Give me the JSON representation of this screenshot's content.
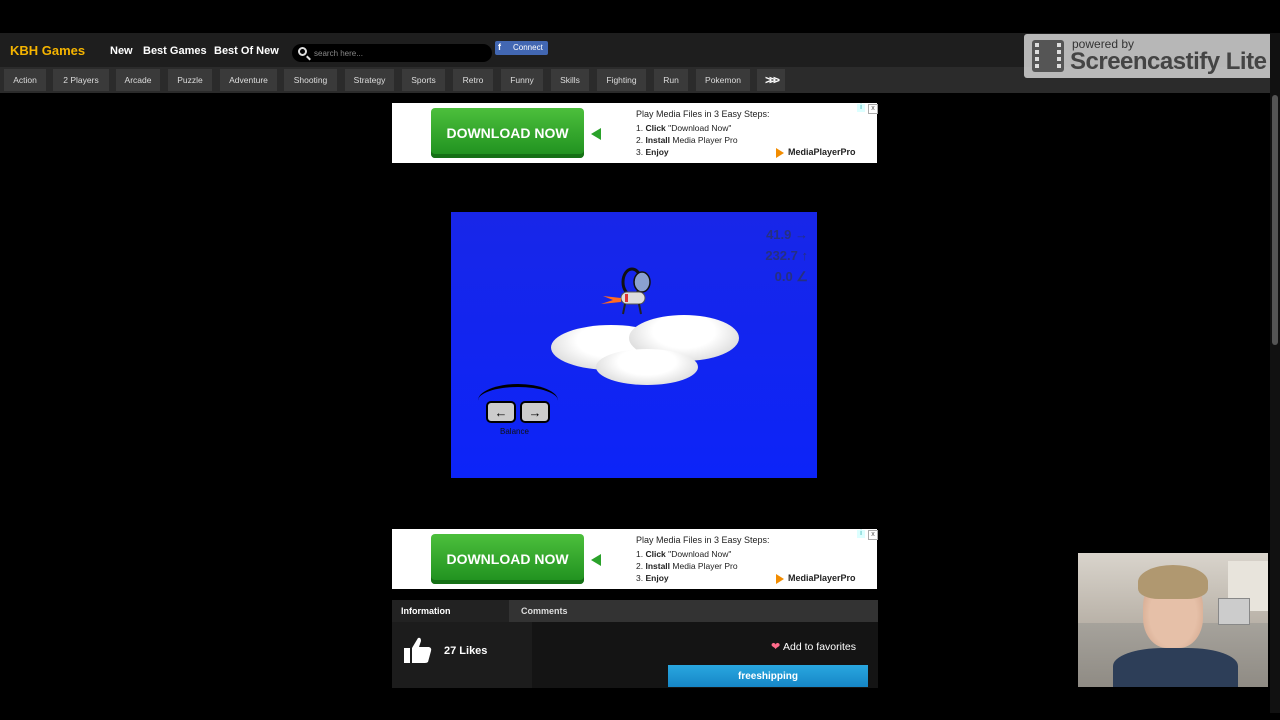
{
  "header": {
    "logo": "KBH Games",
    "nav": [
      "New",
      "Best Games",
      "Best Of New"
    ],
    "search_placeholder": "search here...",
    "facebook_label": "Connect"
  },
  "categories": [
    "Action",
    "2 Players",
    "Arcade",
    "Puzzle",
    "Adventure",
    "Shooting",
    "Strategy",
    "Sports",
    "Retro",
    "Funny",
    "Skills",
    "Fighting",
    "Run",
    "Pokemon"
  ],
  "more_icon": "triple-chevron-right-icon",
  "watermark": {
    "top": "powered by",
    "main": "Screencastify Lite"
  },
  "ad": {
    "button": "DOWNLOAD NOW",
    "title": "Play Media Files in 3 Easy Steps:",
    "step1_num": "1.",
    "step1_bold": "Click",
    "step1_rest": "\"Download Now\"",
    "step2_num": "2.",
    "step2_bold": "Install",
    "step2_rest": "Media Player Pro",
    "step3_num": "3.",
    "step3_bold": "Enjoy",
    "brand": "MediaPlayerPro",
    "close": "x",
    "info": "i"
  },
  "game": {
    "stat_distance": "41.9 →",
    "stat_height": "232.7 ↑",
    "stat_angle": "0.0 ∠",
    "key_left": "←",
    "key_right": "→",
    "balance_label": "Balance"
  },
  "info": {
    "tab_information": "Information",
    "tab_comments": "Comments",
    "likes": "27 Likes",
    "favorites": "Add to favorites",
    "heart": "❤",
    "shipping_ad": "freeshipping"
  },
  "colors": {
    "logo": "#f5b400",
    "game_bg": "#0c24f8",
    "ad_green": "#2aa22a",
    "facebook": "#4267b2"
  }
}
